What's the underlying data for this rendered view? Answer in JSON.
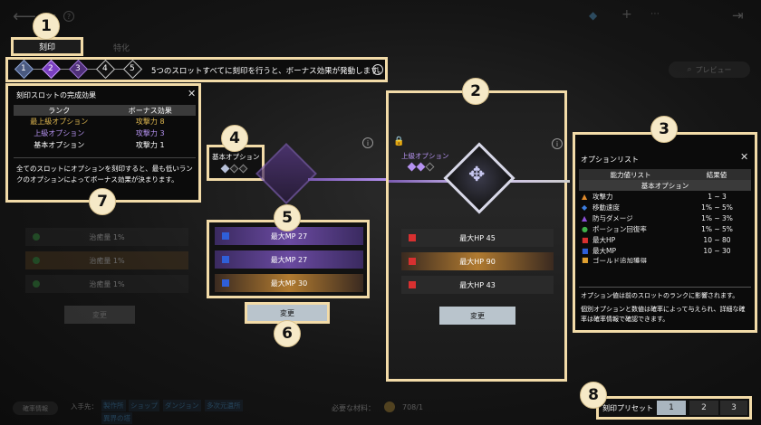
{
  "topbar": {
    "back_title": "刻印",
    "help": "?"
  },
  "tabs": [
    {
      "label": "刻印"
    },
    {
      "label": "特化"
    }
  ],
  "badges": [
    "1",
    "2",
    "3",
    "4",
    "5",
    "6",
    "7",
    "8"
  ],
  "slots_bar": {
    "steps": [
      "1",
      "2",
      "3",
      "4",
      "5"
    ],
    "message": "5つのスロットすべてに刻印を行うと、ボーナス効果が発動します。",
    "info": "i"
  },
  "preview_button": "プレビュー",
  "completion_popup": {
    "title": "刻印スロットの完成効果",
    "close": "✕",
    "headers": [
      "ランク",
      "ボーナス効果"
    ],
    "rows": [
      {
        "rank": "最上級オプション",
        "effect": "攻撃力 8",
        "color": "#e0b850"
      },
      {
        "rank": "上級オプション",
        "effect": "攻撃力 3",
        "color": "#b592f0"
      },
      {
        "rank": "基本オプション",
        "effect": "攻撃力 1",
        "color": "#ffffff"
      }
    ],
    "footer": "全てのスロットにオプションを刻印すると、最も低いランクのオプションによってボーナス効果が決まります。"
  },
  "left_ghost": {
    "rows": [
      "治癒量 1%",
      "治癒量 1%",
      "治癒量 1%"
    ],
    "button": "変更"
  },
  "slot_basic": {
    "label": "基本オプション"
  },
  "middle_options": {
    "rows": [
      {
        "label": "最大MP 27",
        "style": "purple"
      },
      {
        "label": "最大MP 27",
        "style": "purple"
      },
      {
        "label": "最大MP 30",
        "style": "gold"
      }
    ],
    "button": "変更"
  },
  "slot_advanced": {
    "label": "上級オプション",
    "rows": [
      {
        "label": "最大HP 45",
        "style": "dark"
      },
      {
        "label": "最大HP 90",
        "style": "gold"
      },
      {
        "label": "最大HP 43",
        "style": "dark"
      }
    ],
    "button": "変更"
  },
  "option_list": {
    "title": "オプションリスト",
    "close": "✕",
    "headers": [
      "能力値リスト",
      "結果値"
    ],
    "section": "基本オプション",
    "rows": [
      {
        "name": "攻撃力",
        "value": "1 ~ 3",
        "icon": "attack-icon",
        "color": "#e08a2a"
      },
      {
        "name": "移動速度",
        "value": "1% ~ 5%",
        "icon": "speed-icon",
        "color": "#3d7ee0"
      },
      {
        "name": "防与ダメージ",
        "value": "1% ~ 3%",
        "icon": "damage-icon",
        "color": "#8d4fd8"
      },
      {
        "name": "ポーション回復率",
        "value": "1% ~ 5%",
        "icon": "potion-icon",
        "color": "#3fb04a"
      },
      {
        "name": "最大HP",
        "value": "10 ~ 80",
        "icon": "hp-icon",
        "color": "#d83030"
      },
      {
        "name": "最大MP",
        "value": "10 ~ 30",
        "icon": "mp-icon",
        "color": "#2f5fd8"
      },
      {
        "name": "ゴールド追加獲得",
        "value": "",
        "icon": "gold-icon",
        "color": "#e0a030"
      }
    ],
    "note1": "オプション値は前のスロットのランクに影響されます。",
    "note2": "個別オプションと数値は確率によって与えられ、詳細な確率は確率情報で確認できます。"
  },
  "bottom": {
    "prob_info": "確率情報",
    "acquire_label": "入手先：",
    "acquire_links": [
      "製作所",
      "ショップ",
      "ダンジョン",
      "多次元遺所",
      "異界の塔"
    ],
    "materials_label": "必要な材料：",
    "materials_value": "708/1"
  },
  "preset": {
    "label": "刻印プリセット",
    "buttons": [
      "1",
      "2",
      "3"
    ],
    "selected": "1"
  }
}
